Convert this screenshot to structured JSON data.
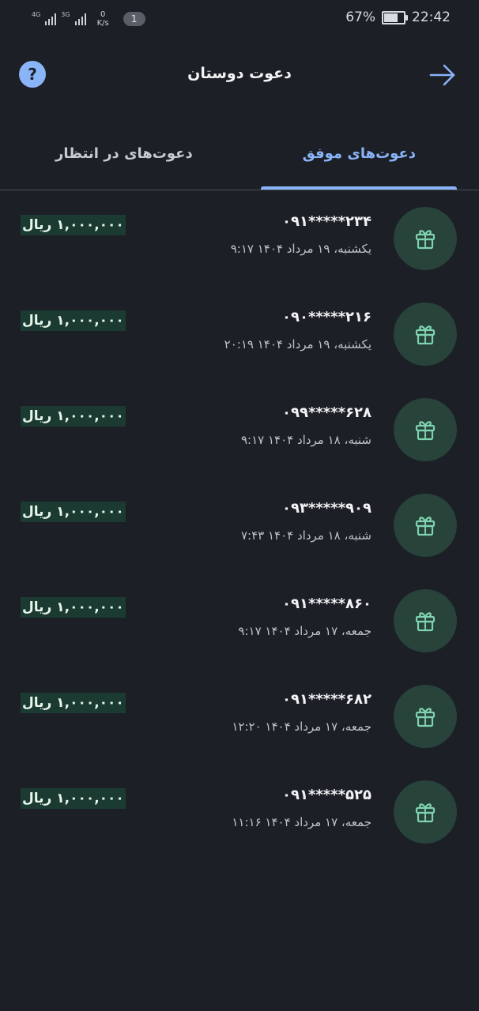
{
  "status_bar": {
    "net1": "4G",
    "net2": "3G",
    "speed_value": "0",
    "speed_unit": "K/s",
    "notification_count": "1",
    "battery": "67%",
    "battery_level": 0.67,
    "time": "22:42"
  },
  "header": {
    "title": "دعوت دوستان",
    "help_icon": "question-mark-circle-icon",
    "back_icon": "arrow-right-icon"
  },
  "tabs": [
    {
      "label": "دعوت‌های موفق",
      "active": true
    },
    {
      "label": "دعوت‌های در انتظار",
      "active": false
    }
  ],
  "invites": [
    {
      "phone": "۰۹۱*****۲۳۴",
      "date": "یکشنبه، ۱۹ مرداد ۱۴۰۴ ۹:۱۷",
      "amount": "۱,۰۰۰,۰۰۰ ریال"
    },
    {
      "phone": "۰۹۰*****۲۱۶",
      "date": "یکشنبه، ۱۹ مرداد ۱۴۰۴ ۲۰:۱۹",
      "amount": "۱,۰۰۰,۰۰۰ ریال"
    },
    {
      "phone": "۰۹۹*****۶۲۸",
      "date": "شنبه، ۱۸ مرداد ۱۴۰۴ ۹:۱۷",
      "amount": "۱,۰۰۰,۰۰۰ ریال"
    },
    {
      "phone": "۰۹۳*****۹۰۹",
      "date": "شنبه، ۱۸ مرداد ۱۴۰۴ ۷:۴۳",
      "amount": "۱,۰۰۰,۰۰۰ ریال"
    },
    {
      "phone": "۰۹۱*****۸۶۰",
      "date": "جمعه، ۱۷ مرداد ۱۴۰۴ ۹:۱۷",
      "amount": "۱,۰۰۰,۰۰۰ ریال"
    },
    {
      "phone": "۰۹۱*****۶۸۲",
      "date": "جمعه، ۱۷ مرداد ۱۴۰۴ ۱۲:۲۰",
      "amount": "۱,۰۰۰,۰۰۰ ریال"
    },
    {
      "phone": "۰۹۱*****۵۲۵",
      "date": "جمعه، ۱۷ مرداد ۱۴۰۴ ۱۱:۱۶",
      "amount": "۱,۰۰۰,۰۰۰ ریال"
    }
  ],
  "colors": {
    "background": "#1c1f26",
    "accent": "#8ab4f8",
    "gift_circle": "#27433a",
    "gift_icon": "#7fd3b0",
    "amount_bg": "#1b3b32"
  }
}
